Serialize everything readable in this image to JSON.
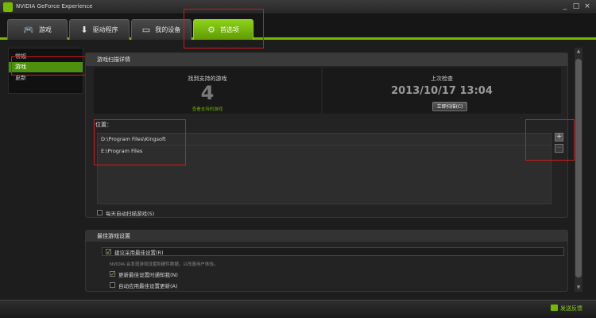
{
  "window": {
    "title": "NVIDIA GeForce Experience",
    "controls": [
      "_",
      "□",
      "×"
    ]
  },
  "tabs": [
    {
      "label": "游戏",
      "icon": "gamepad-icon"
    },
    {
      "label": "驱动程序",
      "icon": "download-icon"
    },
    {
      "label": "我的设备",
      "icon": "monitor-icon"
    },
    {
      "label": "首选项",
      "icon": "gears-icon",
      "active": true
    }
  ],
  "sidebar": {
    "items": [
      {
        "label": "常规"
      },
      {
        "label": "游戏",
        "active": true
      },
      {
        "label": "更新"
      }
    ]
  },
  "scan_panel": {
    "title": "游戏扫描详情",
    "found_label": "找到支持的游戏",
    "found_count": "4",
    "supported_link": "查看支持的游戏",
    "last_check_label": "上次检查",
    "last_check_date": "2013/10/17 13:04",
    "scan_now_button": "立即扫描(C)",
    "location_label": "位置：",
    "locations": [
      "D:\\Program Files\\Kingsoft",
      "E:\\Program Files"
    ],
    "add_button": "+",
    "remove_button": "−",
    "auto_scan_label": "每天自动扫描游戏(S)",
    "auto_scan_checked": false
  },
  "optimize_panel": {
    "title": "最佳游戏设置",
    "recommend_label": "建议采用最佳设置(R)",
    "recommend_checked": true,
    "hint": "NVIDIA 会发现游戏设置和硬件数据，以改善用户体验。",
    "update_label": "更新最佳设置时通知我(N)",
    "update_checked": true,
    "auto_apply_label": "自动应用最佳设置更新(A)",
    "auto_apply_checked": false
  },
  "footer": {
    "feedback_label": "发送反馈"
  },
  "colors": {
    "accent": "#76b900",
    "highlight_box": "#d21a1a",
    "background": "#1d1d1d"
  }
}
